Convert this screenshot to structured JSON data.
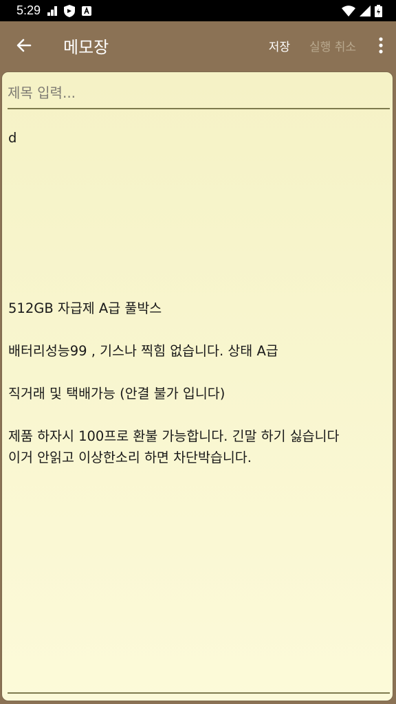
{
  "status_bar": {
    "time": "5:29",
    "icons": [
      "notification-bars-icon",
      "shield-vpn-icon",
      "app-a-icon",
      "wifi-icon",
      "signal-icon",
      "battery-icon"
    ]
  },
  "app_bar": {
    "title": "메모장",
    "save_label": "저장",
    "undo_label": "실행 취소"
  },
  "note": {
    "title_placeholder": "제목 입력...",
    "body": "d\n\n\n\n\n\n\n\n512GB 자급제 A급 풀박스\n\n배터리성능99 , 기스나 찍힘 없습니다. 상태 A급\n\n직거래 및 택배가능 (안결 불가 입니다)\n\n제품 하자시 100프로 환불 가능합니다. 긴말 하기 싫습니다\n이거 안읽고 이상한소리 하면 차단박습니다."
  },
  "colors": {
    "app_bar": "#8b7255",
    "paper": "#fcfad9",
    "line": "#7d7a4d"
  }
}
